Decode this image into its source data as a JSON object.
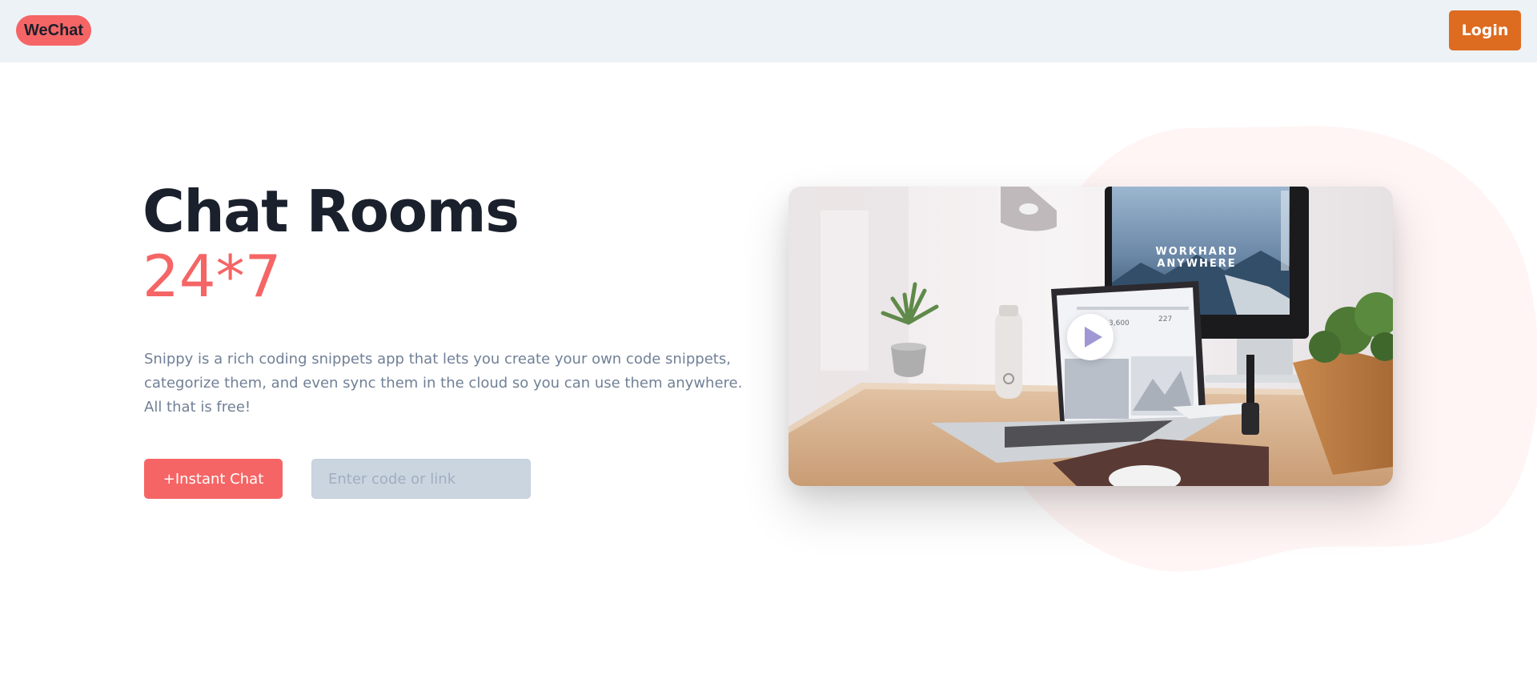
{
  "navbar": {
    "logo_text": "WeChat",
    "login_label": "Login"
  },
  "hero": {
    "title": "Chat Rooms",
    "subtitle": "24*7",
    "description": "Snippy is a rich coding snippets app that lets you create your own code snippets, categorize them, and even sync them in the cloud so you can use them anywhere. All that is free!",
    "instant_chat_label": "+Instant Chat",
    "code_input_placeholder": "Enter code or link",
    "code_input_value": ""
  },
  "media": {
    "screen_text": "WORKHARD ANYWHERE",
    "play_icon": "play-icon"
  },
  "colors": {
    "accent": "#f56565",
    "login": "#dd6b20",
    "navbar_bg": "#edf2f7",
    "heading": "#1a202c",
    "body_text": "#718096",
    "input_bg": "#cbd5e0",
    "blob": "#fff5f5"
  }
}
